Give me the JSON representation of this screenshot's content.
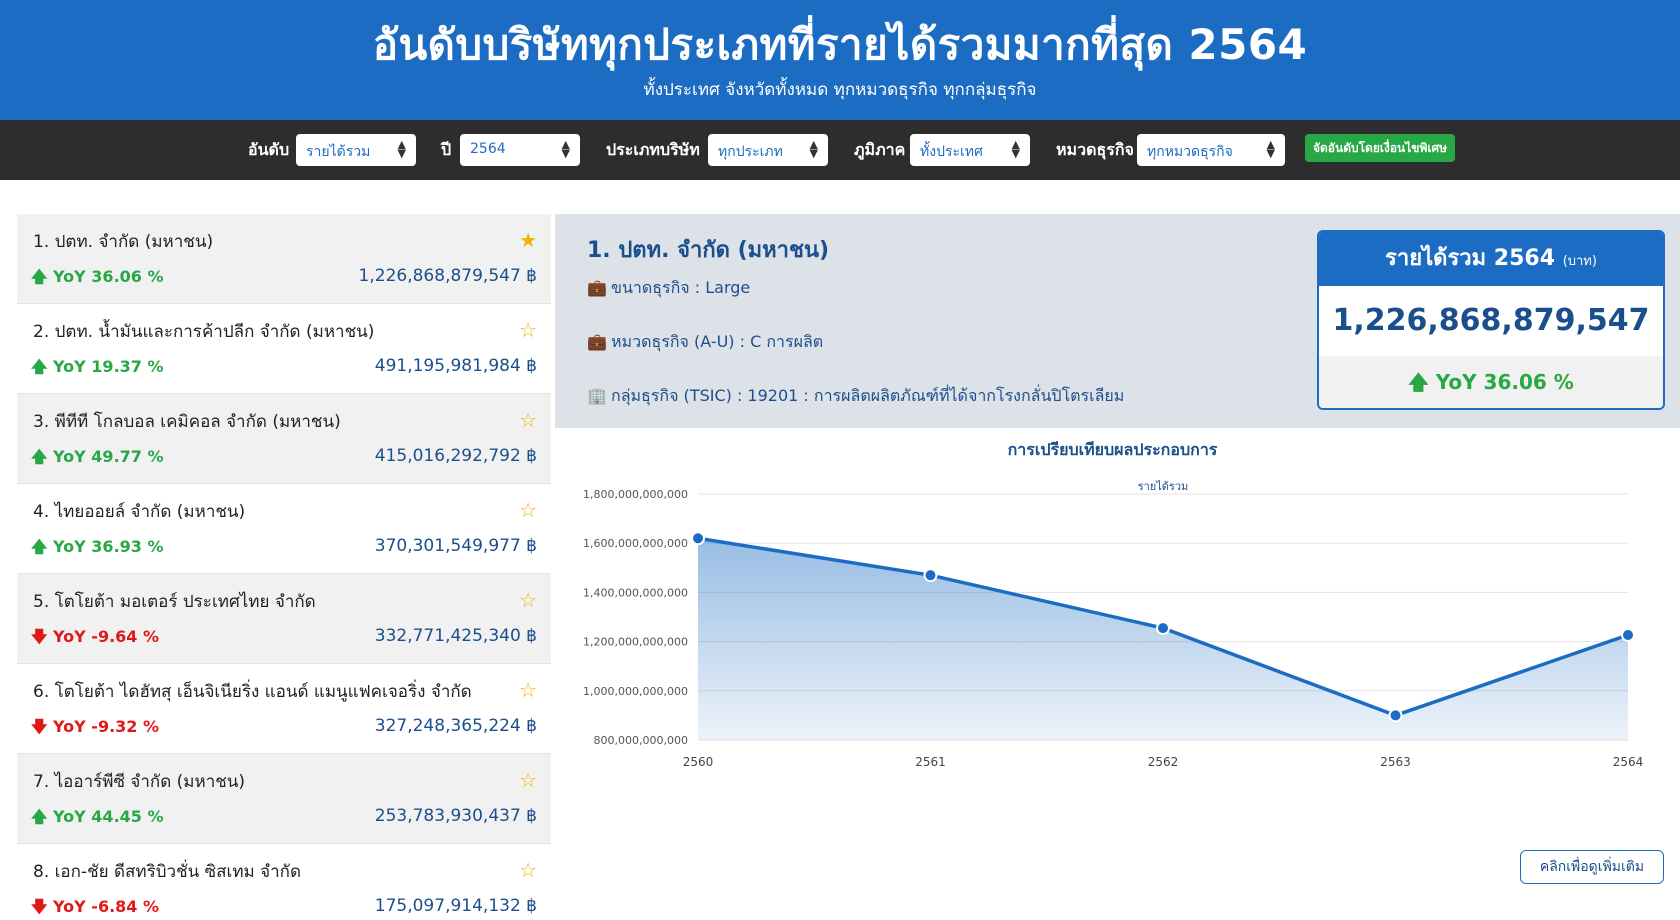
{
  "header": {
    "title": "อันดับบริษัททุกประเภทที่รายได้รวมมากที่สุด 2564",
    "subtitle": "ทั้งประเทศ จังหวัดทั้งหมด ทุกหมวดธุรกิจ ทุกกลุ่มธุรกิจ"
  },
  "filters": {
    "rank_label": "อันดับ",
    "rank_value": "รายได้รวม",
    "year_label": "ปี",
    "year_value": "2564",
    "type_label": "ประเภทบริษัท",
    "type_value": "ทุกประเภท",
    "region_label": "ภูมิภาค",
    "region_value": "ทั้งประเทศ",
    "category_label": "หมวดธุรกิจ",
    "category_value": "ทุกหมวดธุรกิจ",
    "special_button": "จัดอันดับโดยเงื่อนไขพิเศษ"
  },
  "ranking": [
    {
      "name": "1. ปตท. จำกัด (มหาชน)",
      "yoy": "YoY 36.06 %",
      "direction": "up",
      "value": "1,226,868,879,547 ฿",
      "starred": true
    },
    {
      "name": "2. ปตท. น้ำมันและการค้าปลีก จำกัด (มหาชน)",
      "yoy": "YoY 19.37 %",
      "direction": "up",
      "value": "491,195,981,984 ฿",
      "starred": false
    },
    {
      "name": "3. พีทีที โกลบอล เคมิคอล จำกัด (มหาชน)",
      "yoy": "YoY 49.77 %",
      "direction": "up",
      "value": "415,016,292,792 ฿",
      "starred": false
    },
    {
      "name": "4. ไทยออยล์ จำกัด (มหาชน)",
      "yoy": "YoY 36.93 %",
      "direction": "up",
      "value": "370,301,549,977 ฿",
      "starred": false
    },
    {
      "name": "5. โตโยต้า มอเตอร์ ประเทศไทย จำกัด",
      "yoy": "YoY -9.64 %",
      "direction": "down",
      "value": "332,771,425,340 ฿",
      "starred": false
    },
    {
      "name": "6. โตโยต้า ไดฮัทสุ เอ็นจิเนียริ่ง แอนด์ แมนูแฟคเจอริ่ง จำกัด",
      "yoy": "YoY -9.32 %",
      "direction": "down",
      "value": "327,248,365,224 ฿",
      "starred": false
    },
    {
      "name": "7. ไออาร์พีซี จำกัด (มหาชน)",
      "yoy": "YoY 44.45 %",
      "direction": "up",
      "value": "253,783,930,437 ฿",
      "starred": false
    },
    {
      "name": "8. เอก-ชัย ดีสทริบิวชั่น ซิสเทม จำกัด",
      "yoy": "YoY -6.84 %",
      "direction": "down",
      "value": "175,097,914,132 ฿",
      "starred": false
    }
  ],
  "detail": {
    "title": "1. ปตท. จำกัด (มหาชน)",
    "size": "ขนาดธุรกิจ : Large",
    "category": "หมวดธุรกิจ (A-U) : C การผลิต",
    "group": "กลุ่มธุรกิจ (TSIC) : 19201 : การผลิตผลิตภัณฑ์ที่ได้จากโรงกลั่นปิโตรเลียม"
  },
  "revenue_card": {
    "heading": "รายได้รวม 2564",
    "unit": "(บาท)",
    "value": "1,226,868,879,547",
    "yoy": "YoY 36.06 %"
  },
  "chart_section_title": "การเปรียบเทียบผลประกอบการ",
  "more_button": "คลิกเพื่อดูเพิ่มเติม",
  "colors": {
    "brand": "#1b6cc2",
    "up": "#27a844",
    "down": "#e01818",
    "star": "#f0b400"
  },
  "chart_data": {
    "type": "area",
    "title": "รายได้รวม",
    "categories": [
      "2560",
      "2561",
      "2562",
      "2563",
      "2564"
    ],
    "series": [
      {
        "values": [
          1620000000000,
          1470000000000,
          1255000000000,
          900000000000,
          1226868879547
        ]
      }
    ],
    "y_ticks": [
      "800,000,000,000",
      "1,000,000,000,000",
      "1,200,000,000,000",
      "1,400,000,000,000",
      "1,600,000,000,000",
      "1,800,000,000,000"
    ],
    "ylim": [
      800000000000,
      1800000000000
    ],
    "grid": true,
    "legend": "none"
  }
}
